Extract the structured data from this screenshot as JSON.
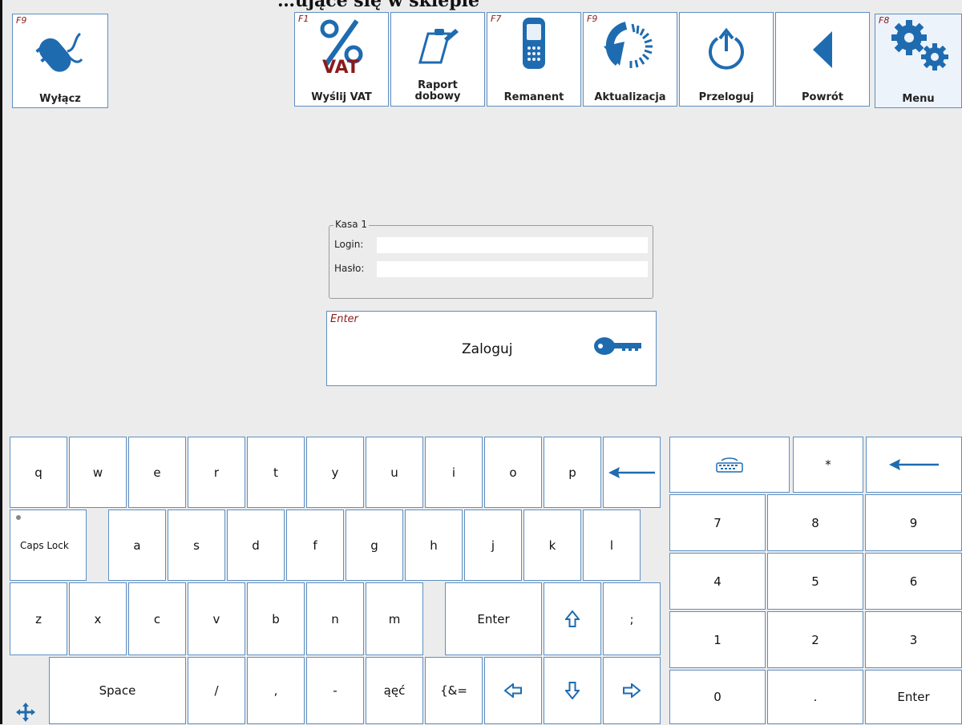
{
  "window": {
    "partial_title": "…ujące się w sklepie"
  },
  "toolbar": {
    "power": {
      "fkey": "F9",
      "label": "Wyłącz",
      "icon": "power-plug-icon"
    },
    "vat": {
      "fkey": "F1",
      "label": "Wyślij VAT",
      "icon": "percent-vat-icon",
      "icon_text": "VAT"
    },
    "report": {
      "fkey": "",
      "label_line1": "Raport",
      "label_line2": "dobowy",
      "icon": "clipboard-icon"
    },
    "inventory": {
      "fkey": "F7",
      "label": "Remanent",
      "icon": "phone-scanner-icon"
    },
    "update": {
      "fkey": "F9",
      "label": "Aktualizacja",
      "icon": "refresh-icon"
    },
    "relogin": {
      "fkey": "",
      "label": "Przeloguj",
      "icon": "power-cycle-icon"
    },
    "back": {
      "fkey": "",
      "label": "Powrót",
      "icon": "back-triangle-icon"
    },
    "menu": {
      "fkey": "F8",
      "label": "Menu",
      "icon": "gears-icon"
    }
  },
  "login": {
    "group_title": "Kasa 1",
    "login_label": "Login:",
    "login_value": "",
    "password_label": "Hasło:",
    "password_value": "",
    "button_fkey": "Enter",
    "button_label": "Zaloguj",
    "button_icon": "key-icon"
  },
  "keyboard": {
    "row1": [
      "q",
      "w",
      "e",
      "r",
      "t",
      "y",
      "u",
      "i",
      "o",
      "p"
    ],
    "backspace_icon": "backspace-arrow-icon",
    "caps_lock": "Caps Lock",
    "row2": [
      "a",
      "s",
      "d",
      "f",
      "g",
      "h",
      "j",
      "k",
      "l"
    ],
    "row3": [
      "z",
      "x",
      "c",
      "v",
      "b",
      "n",
      "m"
    ],
    "enter": "Enter",
    "shift_icon": "shift-arrow-icon",
    "semicolon": ";",
    "space": "Space",
    "row4": [
      "/",
      ",",
      "-",
      "ąęć",
      "{&="
    ],
    "left_icon": "arrow-left-outline-icon",
    "down_icon": "arrow-down-outline-icon",
    "right_icon": "arrow-right-outline-icon",
    "move_icon": "move-arrows-icon"
  },
  "numpad": {
    "keyboard_icon": "keyboard-icon",
    "star": "*",
    "backspace_icon": "backspace-arrow-icon",
    "rows": [
      [
        "7",
        "8",
        "9"
      ],
      [
        "4",
        "5",
        "6"
      ],
      [
        "1",
        "2",
        "3"
      ]
    ],
    "zero": "0",
    "dot": ".",
    "enter": "Enter"
  },
  "colors": {
    "accent": "#1f6bb0",
    "border": "#5d8fc2",
    "fkey": "#8b1a1a",
    "vat_red": "#8b1a1a",
    "background": "#ececec"
  }
}
